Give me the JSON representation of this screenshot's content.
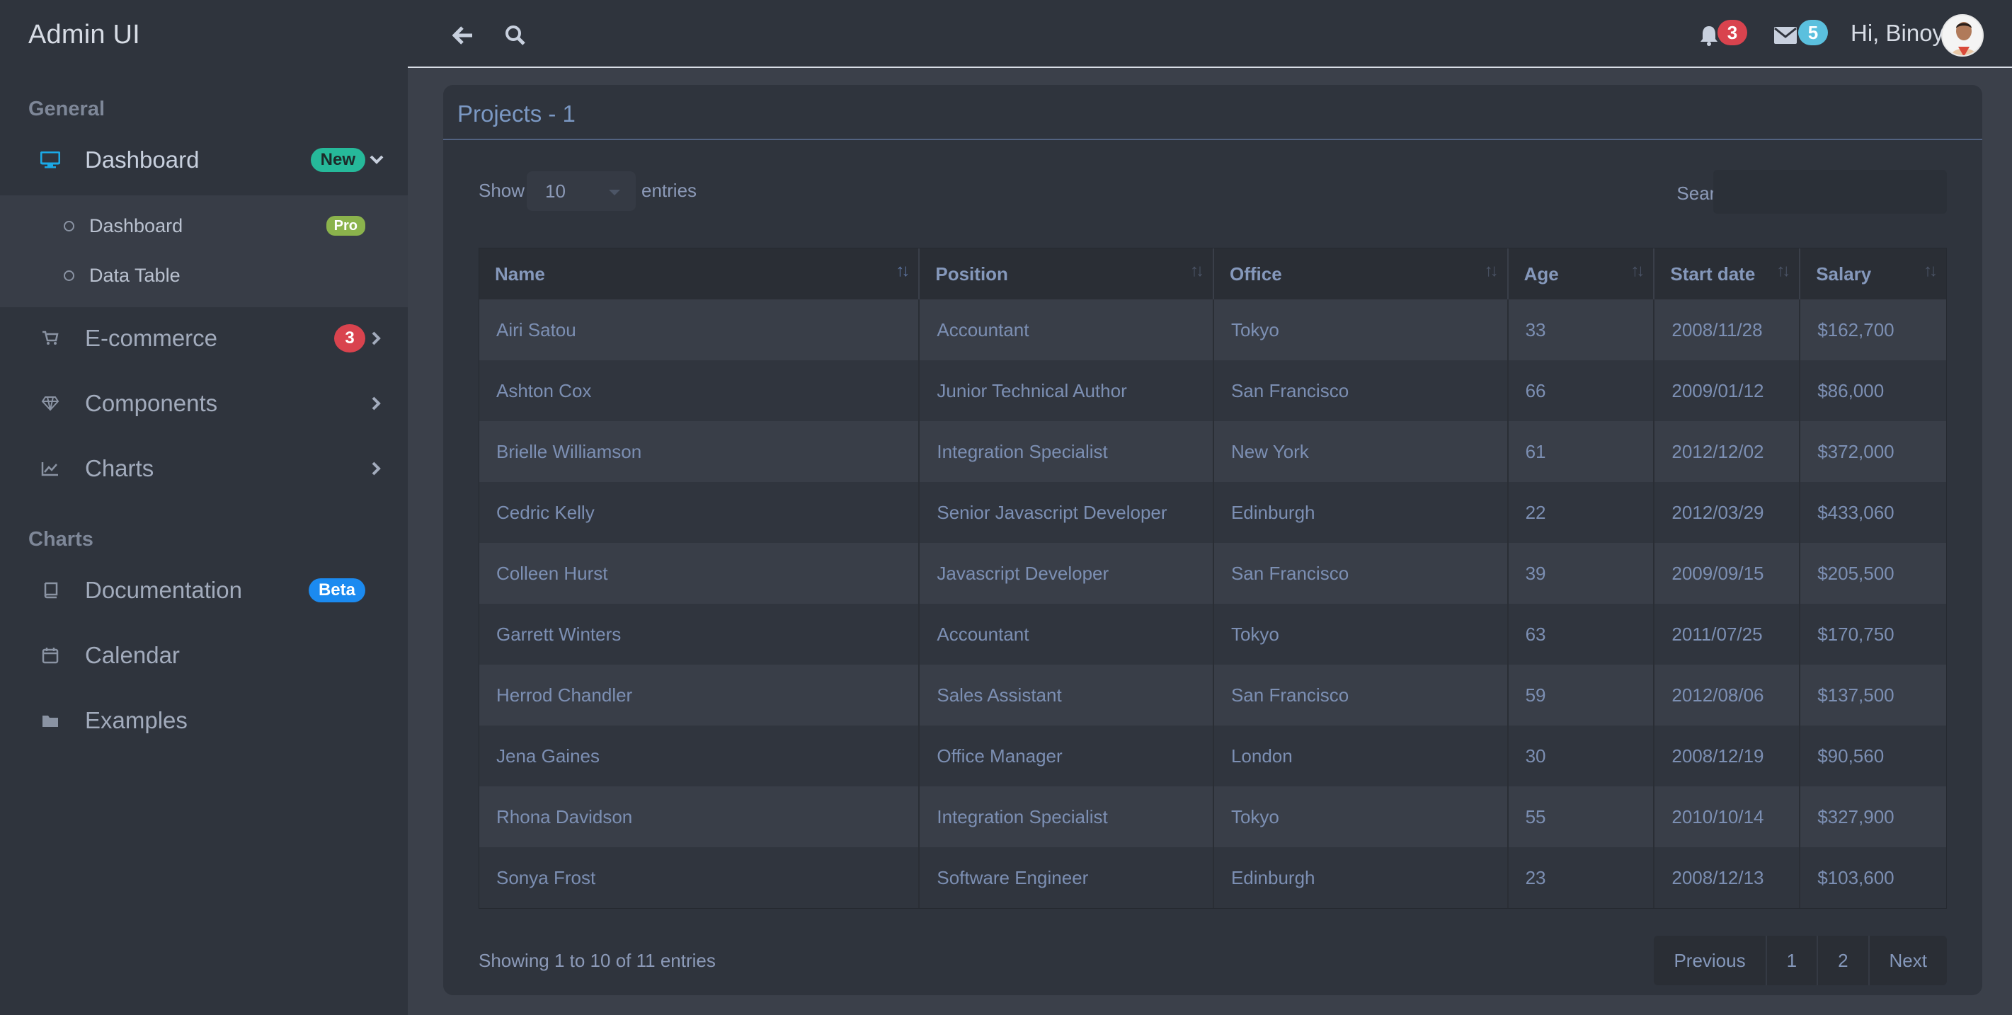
{
  "brand": "Admin UI",
  "sidebar": {
    "section_general": "General",
    "section_charts": "Charts",
    "items": [
      {
        "label": "Dashboard",
        "badge": "New"
      },
      {
        "label": "E-commerce",
        "badge": "3"
      },
      {
        "label": "Components"
      },
      {
        "label": "Charts"
      },
      {
        "label": "Documentation",
        "badge": "Beta"
      },
      {
        "label": "Calendar"
      },
      {
        "label": "Examples"
      }
    ],
    "submenu": [
      {
        "label": "Dashboard",
        "badge": "Pro"
      },
      {
        "label": "Data Table"
      }
    ]
  },
  "topbar": {
    "notifications_count": "3",
    "messages_count": "5",
    "greeting": "Hi, Binoy"
  },
  "card": {
    "title": "Projects - 1",
    "show_label": "Show",
    "entries_label": "entries",
    "page_size": "10",
    "search_label": "Search:",
    "info": "Showing 1 to 10 of 11 entries"
  },
  "table": {
    "headers": [
      "Name",
      "Position",
      "Office",
      "Age",
      "Start date",
      "Salary"
    ],
    "rows": [
      [
        "Airi Satou",
        "Accountant",
        "Tokyo",
        "33",
        "2008/11/28",
        "$162,700"
      ],
      [
        "Ashton Cox",
        "Junior Technical Author",
        "San Francisco",
        "66",
        "2009/01/12",
        "$86,000"
      ],
      [
        "Brielle Williamson",
        "Integration Specialist",
        "New York",
        "61",
        "2012/12/02",
        "$372,000"
      ],
      [
        "Cedric Kelly",
        "Senior Javascript Developer",
        "Edinburgh",
        "22",
        "2012/03/29",
        "$433,060"
      ],
      [
        "Colleen Hurst",
        "Javascript Developer",
        "San Francisco",
        "39",
        "2009/09/15",
        "$205,500"
      ],
      [
        "Garrett Winters",
        "Accountant",
        "Tokyo",
        "63",
        "2011/07/25",
        "$170,750"
      ],
      [
        "Herrod Chandler",
        "Sales Assistant",
        "San Francisco",
        "59",
        "2012/08/06",
        "$137,500"
      ],
      [
        "Jena Gaines",
        "Office Manager",
        "London",
        "30",
        "2008/12/19",
        "$90,560"
      ],
      [
        "Rhona Davidson",
        "Integration Specialist",
        "Tokyo",
        "55",
        "2010/10/14",
        "$327,900"
      ],
      [
        "Sonya Frost",
        "Software Engineer",
        "Edinburgh",
        "23",
        "2008/12/13",
        "$103,600"
      ]
    ]
  },
  "pagination": {
    "previous": "Previous",
    "page1": "1",
    "page2": "2",
    "next": "Next"
  },
  "colors": {
    "badge_new": "#26b99a",
    "badge_red": "#d9434e",
    "badge_beta": "#1b8af0",
    "badge_pro": "#8bb34c",
    "badge_messages": "#5bc0de"
  },
  "icons": [
    "desktop-icon",
    "shopping-cart-icon",
    "diamond-icon",
    "line-chart-icon",
    "book-icon",
    "calendar-icon",
    "folder-icon",
    "arrow-left-icon",
    "search-icon",
    "bell-icon",
    "envelope-icon",
    "chevron-down-icon",
    "chevron-right-icon"
  ]
}
